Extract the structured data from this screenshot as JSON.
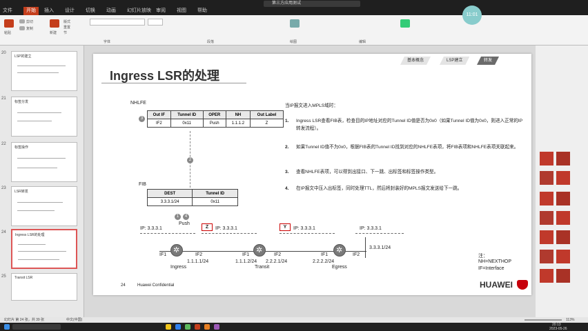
{
  "titlebar": {
    "notification": "第三方应用测试",
    "clock": "11:01"
  },
  "tabs": [
    "文件",
    "开始",
    "插入",
    "设计",
    "切换",
    "动画",
    "幻灯片放映",
    "审阅",
    "视图",
    "帮助"
  ],
  "ribbon": {
    "labels": [
      "粘贴",
      "剪切",
      "复制",
      "新建",
      "版式",
      "重置",
      "节",
      "字体",
      "段落",
      "绘图",
      "编辑"
    ],
    "font_group": "字体"
  },
  "sidebar": {
    "slide_numbers": [
      "20",
      "21",
      "22",
      "23",
      "24",
      "25"
    ],
    "selected_index": 4,
    "thumb_titles": [
      "LSP的建立",
      "标签分发",
      "标签操作",
      "LSR转发",
      "Ingress LSR的处理",
      "Transit LSR"
    ]
  },
  "slide": {
    "title": "Ingress LSR的处理",
    "nav": [
      "基本概念",
      "LSP建立",
      "转发"
    ],
    "nav_current": 2,
    "nhlfe_label": "NHLFE",
    "fib_label": "FIB",
    "nhlfe_headers": [
      "Out IF",
      "Tunnel ID",
      "OPER",
      "NH",
      "Out Label"
    ],
    "nhlfe_row": [
      "IF2",
      "0x11",
      "Push",
      "1.1.1.2",
      "Z"
    ],
    "fib_headers": [
      "DEST",
      "Tunnel ID"
    ],
    "fib_row": [
      "3.3.3.1/24",
      "0x11"
    ],
    "step_marks": [
      "3",
      "2",
      "1",
      "4"
    ],
    "push_label": "Push",
    "packets": [
      {
        "ip": "IP: 3.3.3.1",
        "label": ""
      },
      {
        "ip": "IP: 3.3.3.1",
        "label": "Z"
      },
      {
        "ip": "IP: 3.3.3.1",
        "label": "Y"
      },
      {
        "ip": "IP: 3.3.3.1",
        "label": ""
      }
    ],
    "routers": [
      {
        "name": "Ingress",
        "left_if": "IF1",
        "right_if": "IF2",
        "addr_right": "1.1.1.1/24"
      },
      {
        "name": "Transit",
        "left_if": "IF1",
        "right_if": "IF2",
        "addr_left": "1.1.1.2/24",
        "addr_right": "2.2.2.1/24"
      },
      {
        "name": "Egress",
        "left_if": "IF1",
        "right_if": "IF2",
        "addr_left": "2.2.2.2/24"
      }
    ],
    "dest_net": "3.3.3.1/24",
    "intro": "当IP报文进入MPLS域时：",
    "steps": [
      "Ingress  LSR查看FIB表，检查目的IP地址对应的Tunnel  ID值是否为0x0（如果Tunnel ID值为0x0，则进入正常的IP转发流程）。",
      "如果Tunnel ID值不为0x0，根据FIB表的Tunnel ID找到对应的NHLFE表项，将FIB表项和NHLFE表项关联起来。",
      "查看NHLFE表项，可以得到出接口、下一跳、出标签和标签操作类型。",
      "在IP报文中压入出标签，同时处理TTL，然后将封装好的MPLS报文发送给下一跳。"
    ],
    "step_nums": [
      "1.",
      "2.",
      "3.",
      "4."
    ],
    "notes": [
      "注：",
      "NH=NEXTHOP",
      "IF=Interface"
    ],
    "page_num": "24",
    "footer": "Huawei Confidential",
    "brand": "HUAWEI"
  },
  "statusbar": {
    "left": "幻灯片 第 24 张，共 39 张",
    "lang": "中文(中国)",
    "zoom": "113%"
  },
  "taskbar": {
    "time": "20:13",
    "date": "2023-05-26"
  },
  "colors": {
    "accent": "#c43e1c",
    "huawei_red": "#c7000b"
  }
}
